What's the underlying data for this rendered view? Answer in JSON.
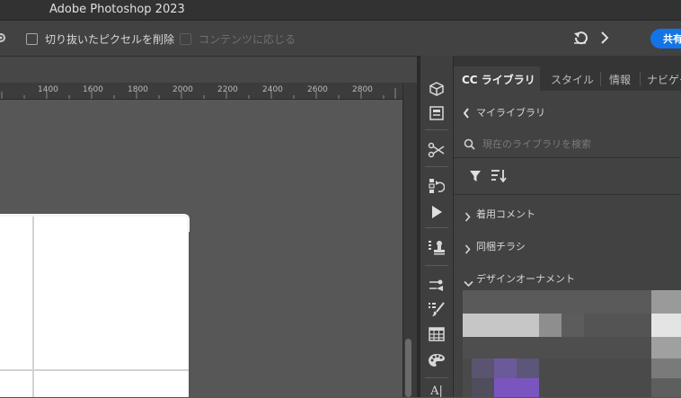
{
  "app": {
    "title": "Adobe Photoshop 2023"
  },
  "options_bar": {
    "delete_cropped_pixels_label": "切り抜いたピクセルを削除",
    "delete_cropped_pixels_checked": false,
    "content_aware_label": "コンテンツに応じる",
    "content_aware_enabled": false,
    "share_label": "共有"
  },
  "ruler": {
    "ticks": [
      "1400",
      "1600",
      "1800",
      "2000",
      "2200",
      "2400",
      "2600",
      "2800"
    ]
  },
  "dock": {
    "icons": [
      "3d-cube-icon",
      "properties-icon",
      "adjustment-brush-icon",
      "history-icon",
      "play-icon",
      "clone-source-icon",
      "brush-settings-icon",
      "brush-presets-icon",
      "table-icon",
      "color-palette-icon",
      "character-icon"
    ],
    "character_glyph": "A|"
  },
  "panel": {
    "tabs": [
      "CC ライブラリ",
      "スタイル",
      "情報",
      "ナビゲーター"
    ],
    "active_tab": 0,
    "back_label": "マイライブラリ",
    "search_placeholder": "現在のライブラリを検索",
    "groups": [
      {
        "label": "着用コメント",
        "expanded": false
      },
      {
        "label": "同梱チラシ",
        "expanded": false
      },
      {
        "label": "デザインオーナメント",
        "expanded": true
      }
    ]
  },
  "colors": {
    "accent": "#1473e6",
    "bg": "#535353",
    "panel": "#424242"
  }
}
